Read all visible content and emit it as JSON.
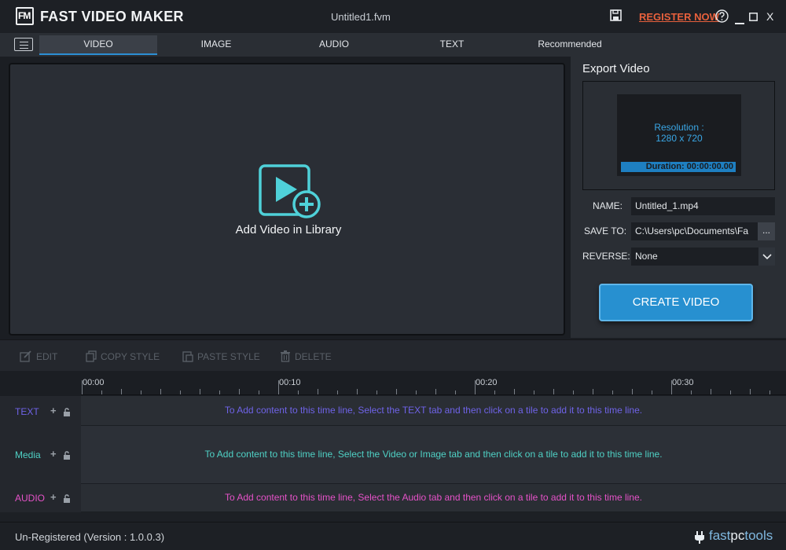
{
  "titlebar": {
    "logo_text": "FM",
    "app_name": "FAST VIDEO MAKER",
    "document": "Untitled1.fvm",
    "register_label": "REGISTER NOW",
    "icons": [
      "save-icon",
      "help-icon",
      "minimize-icon",
      "maximize-icon",
      "close-icon"
    ],
    "close_glyph": "X"
  },
  "tabs": [
    "VIDEO",
    "IMAGE",
    "AUDIO",
    "TEXT",
    "Recommended"
  ],
  "active_tab": "VIDEO",
  "preview": {
    "add_label": "Add Video in Library",
    "icon": "video-add-icon"
  },
  "export": {
    "title": "Export Video",
    "resolution_label": "Resolution :",
    "resolution_value": "1280 x 720",
    "duration": "Duration: 00:00:00.00",
    "name_label": "NAME:",
    "name_value": "Untitled_1.mp4",
    "saveto_label": "SAVE TO:",
    "saveto_value": "C:\\Users\\pc\\Documents\\Fa",
    "browse_label": "...",
    "reverse_label": "REVERSE:",
    "reverse_value": "None",
    "create_label": "CREATE VIDEO"
  },
  "edit_toolbar": {
    "edit": "EDIT",
    "copy_style": "COPY STYLE",
    "paste_style": "PASTE STYLE",
    "delete": "DELETE"
  },
  "ruler": {
    "labels": [
      "00:00",
      "00:10",
      "00:20",
      "00:30"
    ]
  },
  "tracks": [
    {
      "name": "TEXT",
      "hint": "To Add content to this time line, Select the TEXT tab and then click on a tile to add it to this time line.",
      "color": "#6f63e8"
    },
    {
      "name": "Media",
      "hint": "To Add content to this time line, Select the Video or Image tab and then click on a tile to add it to this time line.",
      "color": "#4fd1c5"
    },
    {
      "name": "AUDIO",
      "hint": "To Add content to this time line, Select the Audio tab and then click on a tile to add it to this time line.",
      "color": "#e552c8"
    }
  ],
  "status": {
    "text": "Un-Registered (Version : 1.0.0.3)",
    "brand_a": "fast",
    "brand_b": "pc",
    "brand_c": "tools"
  },
  "colors": {
    "accent": "#2790d0",
    "register": "#e8603c",
    "icon_teal": "#4fd1d9"
  }
}
